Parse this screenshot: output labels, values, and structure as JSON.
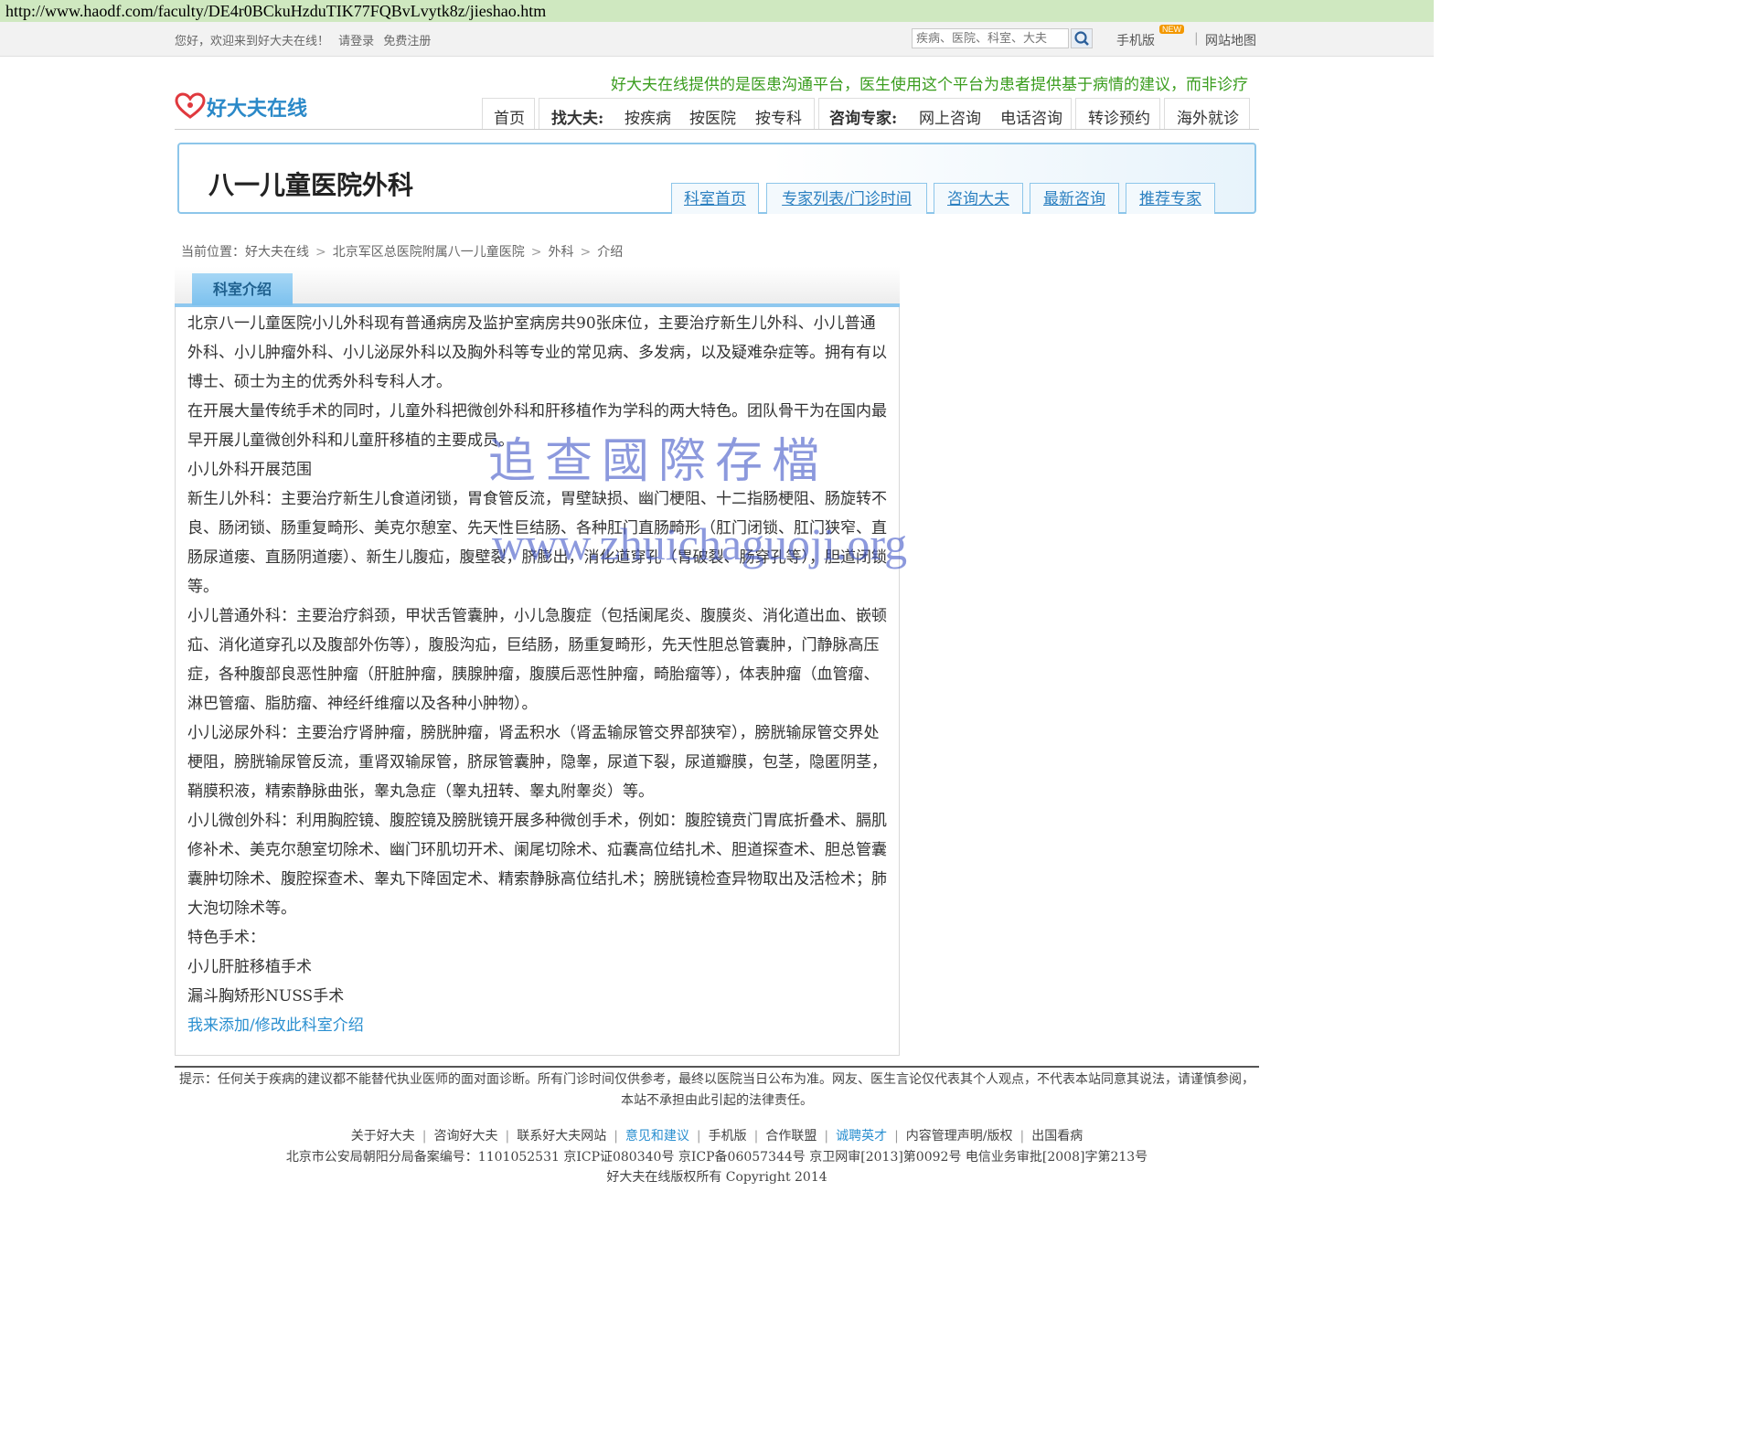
{
  "url": "http://www.haodf.com/faculty/DE4r0BCkuHzduTIK77FQBvLvytk8z/jieshao.htm",
  "topbar": {
    "welcome": "您好，欢迎来到好大夫在线！",
    "login": "请登录",
    "register": "免费注册",
    "search_placeholder": "疾病、医院、科室、大夫",
    "mobile": "手机版",
    "new_badge": "NEW",
    "sitemap": "网站地图"
  },
  "disclaimer": "好大夫在线提供的是医患沟通平台，医生使用这个平台为患者提供基于病情的建议，而非诊疗",
  "logo_text": "好大夫在线",
  "mainnav": {
    "home": "首页",
    "find_label": "找大夫:",
    "by_disease": "按疾病",
    "by_hospital": "按医院",
    "by_dept": "按专科",
    "consult_label": "咨询专家:",
    "online": "网上咨询",
    "phone": "电话咨询",
    "referral": "转诊预约",
    "overseas": "海外就诊"
  },
  "dept": {
    "title": "八一儿童医院外科",
    "tabs": [
      "科室首页",
      "专家列表/门诊时间",
      "咨询大夫",
      "最新咨询",
      "推荐专家"
    ]
  },
  "breadcrumb": {
    "label": "当前位置：",
    "items": [
      "好大夫在线",
      "北京军区总医院附属八一儿童医院",
      "外科",
      "介绍"
    ]
  },
  "panel": {
    "tab": "科室介绍",
    "paragraphs": [
      "北京八一儿童医院小儿外科现有普通病房及监护室病房共90张床位，主要治疗新生儿外科、小儿普通外科、小儿肿瘤外科、小儿泌尿外科以及胸外科等专业的常见病、多发病，以及疑难杂症等。拥有有以博士、硕士为主的优秀外科专科人才。",
      "在开展大量传统手术的同时，儿童外科把微创外科和肝移植作为学科的两大特色。团队骨干为在国内最早开展儿童微创外科和儿童肝移植的主要成员。",
      "小儿外科开展范围",
      "新生儿外科：主要治疗新生儿食道闭锁，胃食管反流，胃壁缺损、幽门梗阻、十二指肠梗阻、肠旋转不良、肠闭锁、肠重复畸形、美克尔憩室、先天性巨结肠、各种肛门直肠畸形（肛门闭锁、肛门狭窄、直肠尿道瘘、直肠阴道瘘）、新生儿腹疝，腹壁裂，脐膨出，消化道穿孔（胃破裂、肠穿孔等），胆道闭锁等。",
      "小儿普通外科：主要治疗斜颈，甲状舌管囊肿，小儿急腹症（包括阑尾炎、腹膜炎、消化道出血、嵌顿疝、消化道穿孔以及腹部外伤等），腹股沟疝，巨结肠，肠重复畸形，先天性胆总管囊肿，门静脉高压症，各种腹部良恶性肿瘤（肝脏肿瘤，胰腺肿瘤，腹膜后恶性肿瘤，畸胎瘤等），体表肿瘤（血管瘤、淋巴管瘤、脂肪瘤、神经纤维瘤以及各种小肿物）。",
      "小儿泌尿外科：主要治疗肾肿瘤，膀胱肿瘤，肾盂积水（肾盂输尿管交界部狭窄），膀胱输尿管交界处梗阻，膀胱输尿管反流，重肾双输尿管，脐尿管囊肿，隐睾，尿道下裂，尿道瓣膜，包茎，隐匿阴茎，鞘膜积液，精索静脉曲张，睾丸急症（睾丸扭转、睾丸附睾炎）等。",
      "小儿微创外科：利用胸腔镜、腹腔镜及膀胱镜开展多种微创手术，例如：腹腔镜贲门胃底折叠术、膈肌修补术、美克尔憩室切除术、幽门环肌切开术、阑尾切除术、疝囊高位结扎术、胆道探查术、胆总管囊囊肿切除术、腹腔探查术、睾丸下降固定术、精索静脉高位结扎术；膀胱镜检查异物取出及活检术；肺大泡切除术等。",
      "特色手术：",
      "小儿肝脏移植手术",
      "漏斗胸矫形NUSS手术"
    ],
    "edit_link": "我来添加/修改此科室介绍"
  },
  "watermark": {
    "line1": "追查國際存檔",
    "line2": "www.zhuichaguoji.org"
  },
  "tip": "提示：任何关于疾病的建议都不能替代执业医师的面对面诊断。所有门诊时间仅供参考，最终以医院当日公布为准。网友、医生言论仅代表其个人观点，不代表本站同意其说法，请谨慎参阅，本站不承担由此引起的法律责任。",
  "footer": {
    "links": [
      "关于好大夫",
      "咨询好大夫",
      "联系好大夫网站",
      "意见和建议",
      "手机版",
      "合作联盟",
      "诚聘英才",
      "内容管理声明/版权",
      "出国看病"
    ],
    "record": "北京市公安局朝阳分局备案编号：1101052531 京ICP证080340号 京ICP备06057344号 京卫网审[2013]第0092号 电信业务审批[2008]字第213号",
    "copyright": "好大夫在线版权所有 Copyright 2014"
  },
  "colors": {
    "accent_blue": "#2a8fd0",
    "disclaimer_green": "#3a9d1e",
    "url_bar_green": "#cfe8c0"
  }
}
